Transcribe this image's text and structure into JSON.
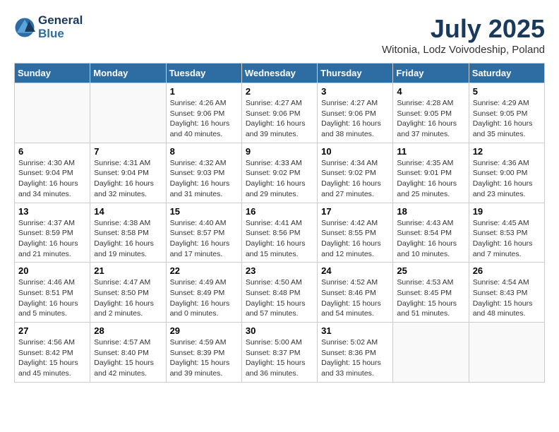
{
  "header": {
    "logo_line1": "General",
    "logo_line2": "Blue",
    "month_year": "July 2025",
    "location": "Witonia, Lodz Voivodeship, Poland"
  },
  "weekdays": [
    "Sunday",
    "Monday",
    "Tuesday",
    "Wednesday",
    "Thursday",
    "Friday",
    "Saturday"
  ],
  "weeks": [
    [
      {
        "day": "",
        "sunrise": "",
        "sunset": "",
        "daylight": ""
      },
      {
        "day": "",
        "sunrise": "",
        "sunset": "",
        "daylight": ""
      },
      {
        "day": "1",
        "sunrise": "Sunrise: 4:26 AM",
        "sunset": "Sunset: 9:06 PM",
        "daylight": "Daylight: 16 hours and 40 minutes."
      },
      {
        "day": "2",
        "sunrise": "Sunrise: 4:27 AM",
        "sunset": "Sunset: 9:06 PM",
        "daylight": "Daylight: 16 hours and 39 minutes."
      },
      {
        "day": "3",
        "sunrise": "Sunrise: 4:27 AM",
        "sunset": "Sunset: 9:06 PM",
        "daylight": "Daylight: 16 hours and 38 minutes."
      },
      {
        "day": "4",
        "sunrise": "Sunrise: 4:28 AM",
        "sunset": "Sunset: 9:05 PM",
        "daylight": "Daylight: 16 hours and 37 minutes."
      },
      {
        "day": "5",
        "sunrise": "Sunrise: 4:29 AM",
        "sunset": "Sunset: 9:05 PM",
        "daylight": "Daylight: 16 hours and 35 minutes."
      }
    ],
    [
      {
        "day": "6",
        "sunrise": "Sunrise: 4:30 AM",
        "sunset": "Sunset: 9:04 PM",
        "daylight": "Daylight: 16 hours and 34 minutes."
      },
      {
        "day": "7",
        "sunrise": "Sunrise: 4:31 AM",
        "sunset": "Sunset: 9:04 PM",
        "daylight": "Daylight: 16 hours and 32 minutes."
      },
      {
        "day": "8",
        "sunrise": "Sunrise: 4:32 AM",
        "sunset": "Sunset: 9:03 PM",
        "daylight": "Daylight: 16 hours and 31 minutes."
      },
      {
        "day": "9",
        "sunrise": "Sunrise: 4:33 AM",
        "sunset": "Sunset: 9:02 PM",
        "daylight": "Daylight: 16 hours and 29 minutes."
      },
      {
        "day": "10",
        "sunrise": "Sunrise: 4:34 AM",
        "sunset": "Sunset: 9:02 PM",
        "daylight": "Daylight: 16 hours and 27 minutes."
      },
      {
        "day": "11",
        "sunrise": "Sunrise: 4:35 AM",
        "sunset": "Sunset: 9:01 PM",
        "daylight": "Daylight: 16 hours and 25 minutes."
      },
      {
        "day": "12",
        "sunrise": "Sunrise: 4:36 AM",
        "sunset": "Sunset: 9:00 PM",
        "daylight": "Daylight: 16 hours and 23 minutes."
      }
    ],
    [
      {
        "day": "13",
        "sunrise": "Sunrise: 4:37 AM",
        "sunset": "Sunset: 8:59 PM",
        "daylight": "Daylight: 16 hours and 21 minutes."
      },
      {
        "day": "14",
        "sunrise": "Sunrise: 4:38 AM",
        "sunset": "Sunset: 8:58 PM",
        "daylight": "Daylight: 16 hours and 19 minutes."
      },
      {
        "day": "15",
        "sunrise": "Sunrise: 4:40 AM",
        "sunset": "Sunset: 8:57 PM",
        "daylight": "Daylight: 16 hours and 17 minutes."
      },
      {
        "day": "16",
        "sunrise": "Sunrise: 4:41 AM",
        "sunset": "Sunset: 8:56 PM",
        "daylight": "Daylight: 16 hours and 15 minutes."
      },
      {
        "day": "17",
        "sunrise": "Sunrise: 4:42 AM",
        "sunset": "Sunset: 8:55 PM",
        "daylight": "Daylight: 16 hours and 12 minutes."
      },
      {
        "day": "18",
        "sunrise": "Sunrise: 4:43 AM",
        "sunset": "Sunset: 8:54 PM",
        "daylight": "Daylight: 16 hours and 10 minutes."
      },
      {
        "day": "19",
        "sunrise": "Sunrise: 4:45 AM",
        "sunset": "Sunset: 8:53 PM",
        "daylight": "Daylight: 16 hours and 7 minutes."
      }
    ],
    [
      {
        "day": "20",
        "sunrise": "Sunrise: 4:46 AM",
        "sunset": "Sunset: 8:51 PM",
        "daylight": "Daylight: 16 hours and 5 minutes."
      },
      {
        "day": "21",
        "sunrise": "Sunrise: 4:47 AM",
        "sunset": "Sunset: 8:50 PM",
        "daylight": "Daylight: 16 hours and 2 minutes."
      },
      {
        "day": "22",
        "sunrise": "Sunrise: 4:49 AM",
        "sunset": "Sunset: 8:49 PM",
        "daylight": "Daylight: 16 hours and 0 minutes."
      },
      {
        "day": "23",
        "sunrise": "Sunrise: 4:50 AM",
        "sunset": "Sunset: 8:48 PM",
        "daylight": "Daylight: 15 hours and 57 minutes."
      },
      {
        "day": "24",
        "sunrise": "Sunrise: 4:52 AM",
        "sunset": "Sunset: 8:46 PM",
        "daylight": "Daylight: 15 hours and 54 minutes."
      },
      {
        "day": "25",
        "sunrise": "Sunrise: 4:53 AM",
        "sunset": "Sunset: 8:45 PM",
        "daylight": "Daylight: 15 hours and 51 minutes."
      },
      {
        "day": "26",
        "sunrise": "Sunrise: 4:54 AM",
        "sunset": "Sunset: 8:43 PM",
        "daylight": "Daylight: 15 hours and 48 minutes."
      }
    ],
    [
      {
        "day": "27",
        "sunrise": "Sunrise: 4:56 AM",
        "sunset": "Sunset: 8:42 PM",
        "daylight": "Daylight: 15 hours and 45 minutes."
      },
      {
        "day": "28",
        "sunrise": "Sunrise: 4:57 AM",
        "sunset": "Sunset: 8:40 PM",
        "daylight": "Daylight: 15 hours and 42 minutes."
      },
      {
        "day": "29",
        "sunrise": "Sunrise: 4:59 AM",
        "sunset": "Sunset: 8:39 PM",
        "daylight": "Daylight: 15 hours and 39 minutes."
      },
      {
        "day": "30",
        "sunrise": "Sunrise: 5:00 AM",
        "sunset": "Sunset: 8:37 PM",
        "daylight": "Daylight: 15 hours and 36 minutes."
      },
      {
        "day": "31",
        "sunrise": "Sunrise: 5:02 AM",
        "sunset": "Sunset: 8:36 PM",
        "daylight": "Daylight: 15 hours and 33 minutes."
      },
      {
        "day": "",
        "sunrise": "",
        "sunset": "",
        "daylight": ""
      },
      {
        "day": "",
        "sunrise": "",
        "sunset": "",
        "daylight": ""
      }
    ]
  ]
}
